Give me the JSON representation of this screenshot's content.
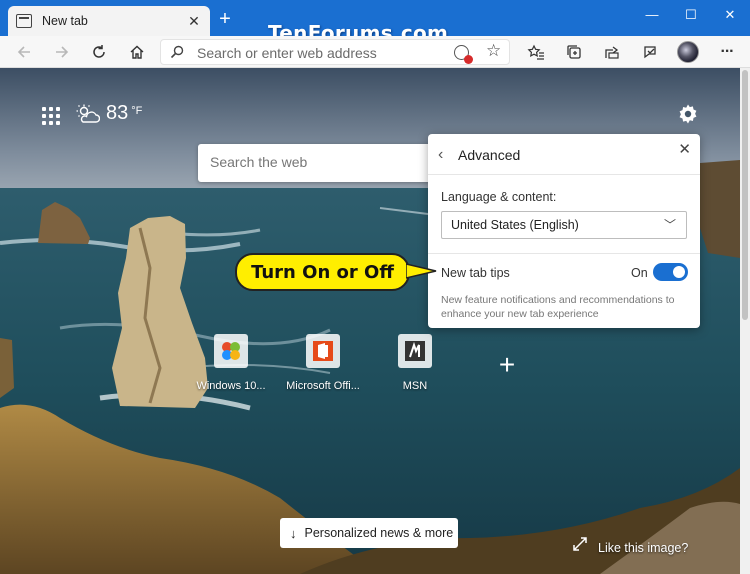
{
  "tab": {
    "title": "New tab",
    "close_glyph": "✕",
    "new_tab_glyph": "+"
  },
  "watermark": "TenForums.com",
  "window_controls": {
    "minimize": "—",
    "maximize": "☐",
    "close": "✕"
  },
  "toolbar": {
    "back_icon": "arrow-left-icon",
    "forward_icon": "arrow-right-icon",
    "refresh_icon": "refresh-icon",
    "home_icon": "home-icon",
    "address_placeholder": "Search or enter web address",
    "menu_glyph": "···"
  },
  "new_tab_page": {
    "weather": {
      "temperature": "83",
      "unit": "°F"
    },
    "search_placeholder": "Search the web",
    "quick_links": [
      {
        "label": "Windows 10...",
        "icon": "windows-logo-icon"
      },
      {
        "label": "Microsoft Offi...",
        "icon": "office-logo-icon"
      },
      {
        "label": "MSN",
        "icon": "msn-logo-icon"
      }
    ],
    "add_glyph": "+",
    "news_button": "Personalized news & more",
    "like_image": "Like this image?"
  },
  "advanced_panel": {
    "title": "Advanced",
    "language_label": "Language & content:",
    "language_value": "United States (English)",
    "new_tab_tips_label": "New tab tips",
    "new_tab_tips_state": "On",
    "new_tab_tips_enabled": true,
    "description": "New feature notifications and recommendations to enhance your new tab experience"
  },
  "callout": {
    "text": "Turn On or Off"
  },
  "colors": {
    "titlebar": "#1a6fd1",
    "toggle_on": "#1a6fd1",
    "callout_fill": "#ffee00"
  }
}
